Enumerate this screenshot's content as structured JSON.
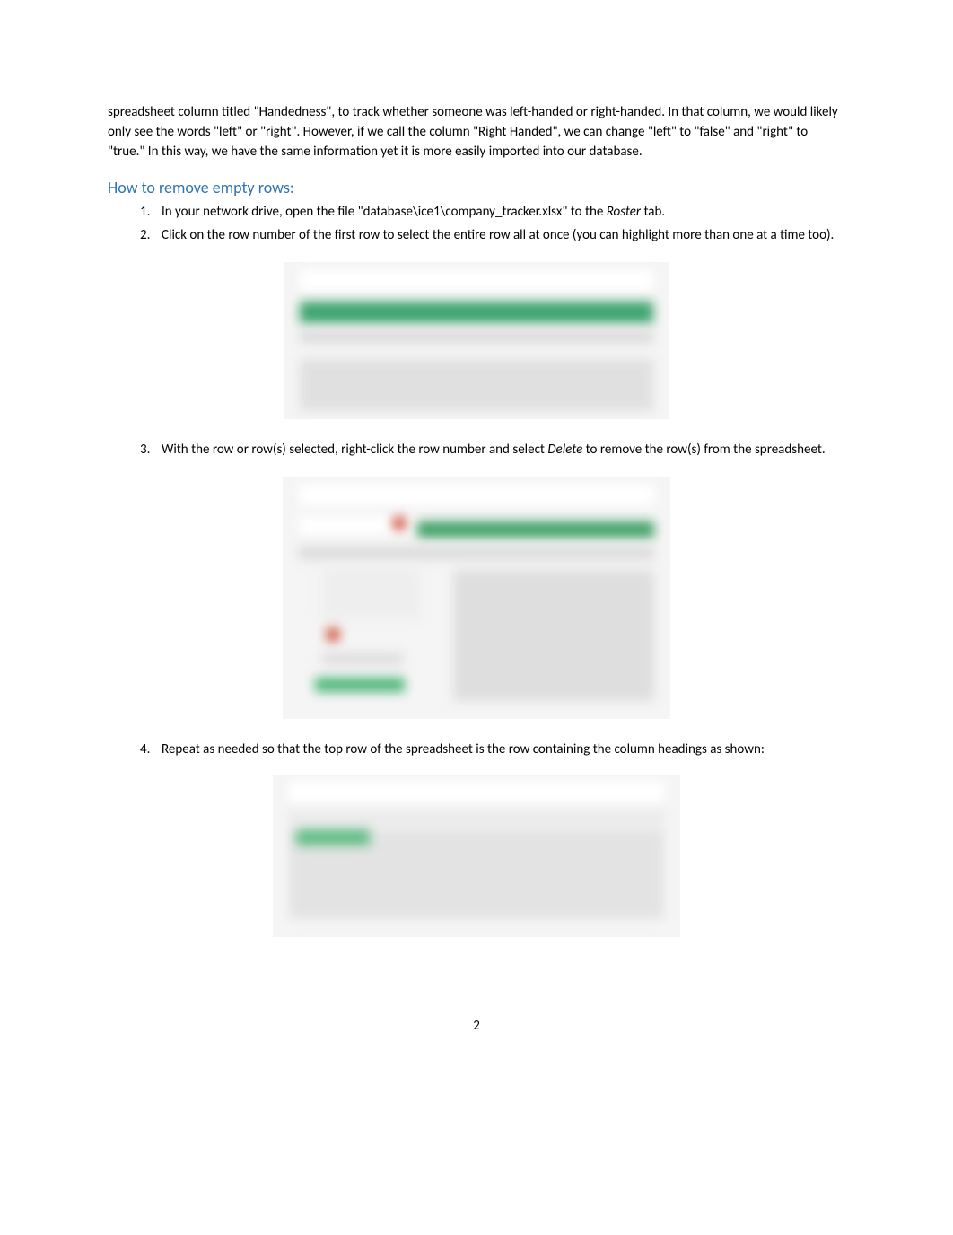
{
  "intro_paragraph": "spreadsheet column titled \"Handedness\", to track whether someone was left-handed or right-handed. In that column, we would likely only see the words \"left\" or \"right\". However, if we call the column \"Right Handed\", we can change \"left\" to \"false\" and \"right\" to \"true.\" In this way, we have the same information yet it is more easily imported into our database.",
  "section_heading": "How to remove empty rows:",
  "steps": [
    {
      "num": "1.",
      "text_before": "In your network drive, open the file \"database\\ice1\\company_tracker.xlsx\" to the ",
      "italic": "Roster",
      "text_after": " tab."
    },
    {
      "num": "2.",
      "text_before": "Click on the row number of the first row to select the entire row all at once (you can highlight more than one at a time too).",
      "italic": "",
      "text_after": ""
    },
    {
      "num": "3.",
      "text_before": "With the row or row(s) selected, right-click the row number and select ",
      "italic": "Delete",
      "text_after": " to remove the row(s) from the spreadsheet."
    },
    {
      "num": "4.",
      "text_before": "Repeat as needed so that the top row of the spreadsheet is the row containing the column headings as shown:",
      "italic": "",
      "text_after": ""
    }
  ],
  "page_number": "2"
}
